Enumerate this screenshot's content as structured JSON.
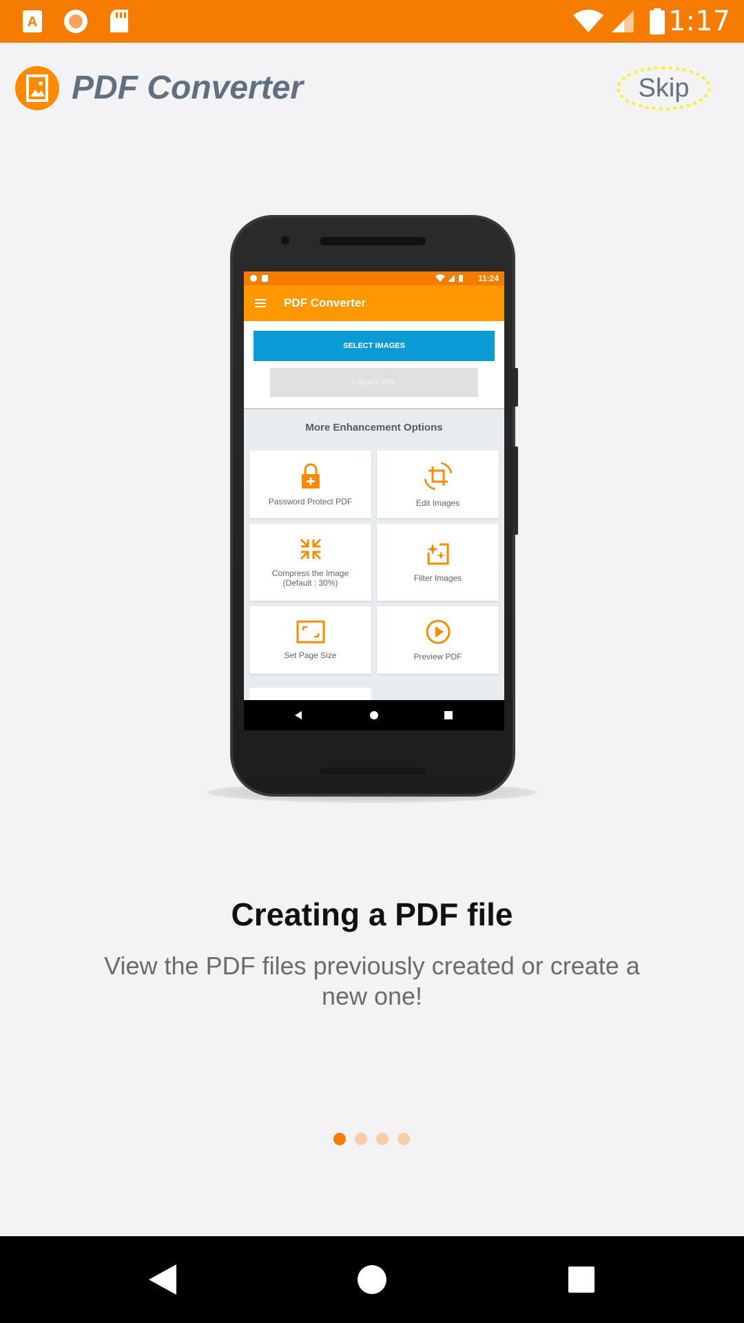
{
  "status_bar": {
    "time": "1:17",
    "left_icons": [
      "text-a-icon",
      "record-icon",
      "sd-card-icon"
    ],
    "right_icons": [
      "wifi-icon",
      "signal-icon",
      "battery-icon"
    ],
    "color": "#f57c00"
  },
  "header": {
    "app_title": "PDF Converter",
    "logo_icon": "image-logo-icon",
    "skip_label": "Skip"
  },
  "mockup": {
    "status_time": "11:24",
    "toolbar_title": "PDF Converter",
    "select_images": "SELECT IMAGES",
    "create_pdf": "CREATE PDF",
    "section_title": "More Enhancement Options",
    "options": [
      {
        "label": "Password Protect PDF",
        "icon": "lock-plus-icon"
      },
      {
        "label": "Edit Images",
        "icon": "crop-rotate-icon"
      },
      {
        "label": "Compress the Image\n(Default : 30%)",
        "icon": "compress-icon"
      },
      {
        "label": "Filter Images",
        "icon": "filter-sparkle-icon"
      },
      {
        "label": "Set Page Size",
        "icon": "page-size-icon"
      },
      {
        "label": "Preview PDF",
        "icon": "play-circle-icon"
      }
    ]
  },
  "slide": {
    "title": "Creating a PDF file",
    "description": "View the PDF files previously created or create a new one!",
    "active_index": 0,
    "total": 4
  },
  "colors": {
    "accent": "#f57c00",
    "toolbar": "#ff9800",
    "select_button": "#0a9ad6",
    "dot_inactive": "#f6cfa8"
  }
}
